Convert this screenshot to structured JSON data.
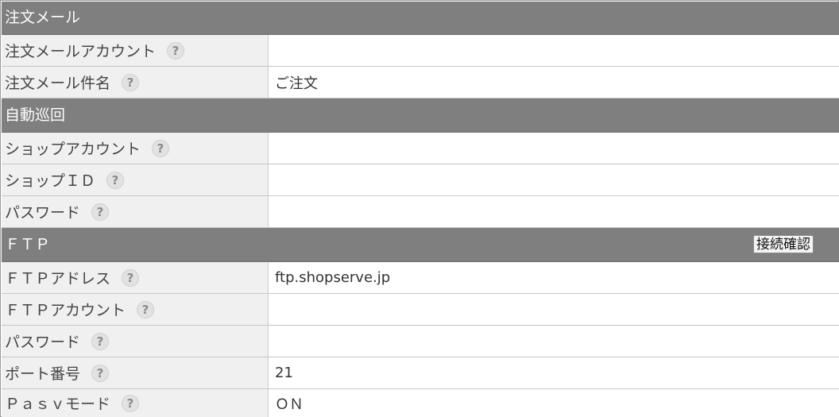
{
  "sections": {
    "order_mail": {
      "title": "注文メール"
    },
    "auto_patrol": {
      "title": "自動巡回"
    },
    "ftp": {
      "title": "ＦＴＰ",
      "connect_button": "接続確認"
    }
  },
  "fields": {
    "order_mail_account": {
      "label": "注文メールアカウント",
      "value": ""
    },
    "order_mail_subject": {
      "label": "注文メール件名",
      "value": "ご注文"
    },
    "shop_account": {
      "label": "ショップアカウント",
      "value": ""
    },
    "shop_id": {
      "label": "ショップＩＤ",
      "value": ""
    },
    "shop_password": {
      "label": "パスワード",
      "value": ""
    },
    "ftp_address": {
      "label": "ＦＴＰアドレス",
      "value": "ftp.shopserve.jp"
    },
    "ftp_account": {
      "label": "ＦＴＰアカウント",
      "value": ""
    },
    "ftp_password": {
      "label": "パスワード",
      "value": ""
    },
    "port_number": {
      "label": "ポート番号",
      "value": "21"
    },
    "pasv_mode": {
      "label": "Ｐａｓｖモード",
      "value": "ＯＮ"
    }
  },
  "help_glyph": "?",
  "colors": {
    "section_bg": "#7f7f7f",
    "label_bg": "#f0f0f0",
    "help_bg": "#e2e2e2"
  },
  "icons": {
    "help": "help-icon"
  }
}
